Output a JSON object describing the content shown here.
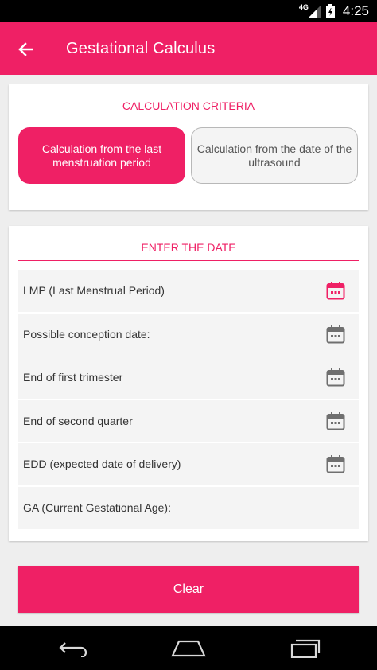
{
  "status_bar": {
    "network": "4G",
    "time": "4:25"
  },
  "app_bar": {
    "title": "Gestational Calculus"
  },
  "criteria": {
    "heading": "CALCULATION CRITERIA",
    "options": [
      {
        "label": "Calculation from the last menstruation period",
        "selected": true
      },
      {
        "label": "Calculation from the date of the ultrasound",
        "selected": false
      }
    ]
  },
  "dates": {
    "heading": "ENTER THE DATE",
    "rows": [
      {
        "label": "LMP (Last Menstrual Period)",
        "icon": "calendar-icon",
        "icon_color": "#ef2065"
      },
      {
        "label": "Possible conception date:",
        "icon": "calendar-icon",
        "icon_color": "#6f6f6f"
      },
      {
        "label": "End of first trimester",
        "icon": "calendar-icon",
        "icon_color": "#6f6f6f"
      },
      {
        "label": "End of second quarter",
        "icon": "calendar-icon",
        "icon_color": "#6f6f6f"
      },
      {
        "label": "EDD (expected date of delivery)",
        "icon": "calendar-icon",
        "icon_color": "#6f6f6f"
      },
      {
        "label": "GA (Current Gestational Age):",
        "icon": "",
        "icon_color": ""
      }
    ]
  },
  "actions": {
    "clear_label": "Clear"
  },
  "colors": {
    "accent": "#ef2065"
  }
}
